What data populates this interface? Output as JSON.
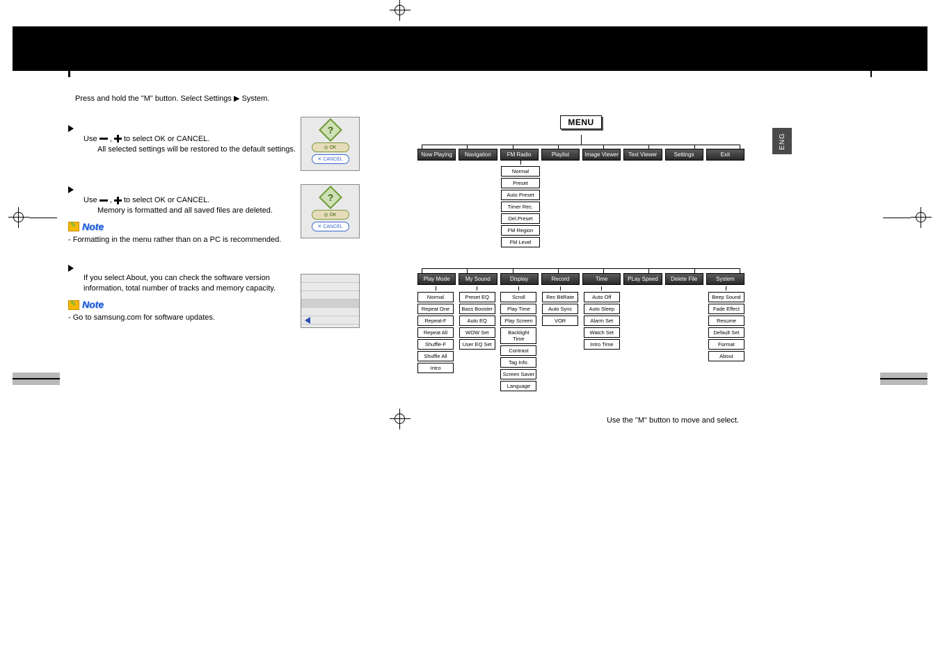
{
  "left": {
    "top_instruction": "Press and hold the \"M\" button. Select Settings  ▶  System.",
    "default_set": {
      "line1_prefix": "Use ",
      "line1_mid": " , ",
      "line1_suffix": " to select OK or CANCEL.",
      "line2": "All selected settings will be restored to the default settings."
    },
    "format": {
      "line1_prefix": "Use ",
      "line1_mid": " , ",
      "line1_suffix": " to select OK or CANCEL.",
      "line2": "Memory is formatted and all saved files are deleted."
    },
    "note1_label": "Note",
    "note1_text": "- Formatting in the menu rather than on a PC is recommended.",
    "about": {
      "line1": "If you select About, you can check the software version",
      "line2": "information, total number of tracks and memory capacity."
    },
    "note2_label": "Note",
    "note2_text": "- Go to samsung.com for software updates.",
    "lcd_ok": "◎  OK",
    "lcd_cancel": "✕ CANCEL"
  },
  "right": {
    "eng": "ENG",
    "menu_label": "MENU",
    "top_tabs": [
      "Now Playing",
      "Navigation",
      "FM Radio",
      "Playlist",
      "Image Viewer",
      "Text Viewer",
      "Settings",
      "Exit"
    ],
    "fm_items": [
      "Normal",
      "Preset",
      "Auto Preset",
      "Timer Rec.",
      "Del.Preset",
      "FM Region",
      "FM Level"
    ],
    "settings_tabs": [
      "Play Mode",
      "My Sound",
      "Display",
      "Record",
      "Time",
      "PLay Speed",
      "Delete File",
      "System"
    ],
    "cols": {
      "PlayMode": [
        "Normal",
        "Repeat One",
        "Repeat-F",
        "Repeat All",
        "Shuffle-F",
        "Shuffle All",
        "Intro"
      ],
      "MySound": [
        "Preset EQ",
        "Bass Booster",
        "Auto EQ",
        "WOW Set",
        "User EQ Set"
      ],
      "Display": [
        "Scroll",
        "Play Time",
        "Play Screen",
        "Backlight Time",
        "Contrast",
        "Tag Info.",
        "Screen Saver",
        "Language"
      ],
      "Record": [
        "Rec BitRate",
        "Auto Sync",
        "VOR"
      ],
      "Time": [
        "Auto Off",
        "Auto Sleep",
        "Alarm Set",
        "Watch Set",
        "Intro Time"
      ],
      "System": [
        "Beep Sound",
        "Fade Effect",
        "Resume",
        "Default Set",
        "Format",
        "About"
      ]
    },
    "footer": "Use the \"M\" button to move and select."
  }
}
